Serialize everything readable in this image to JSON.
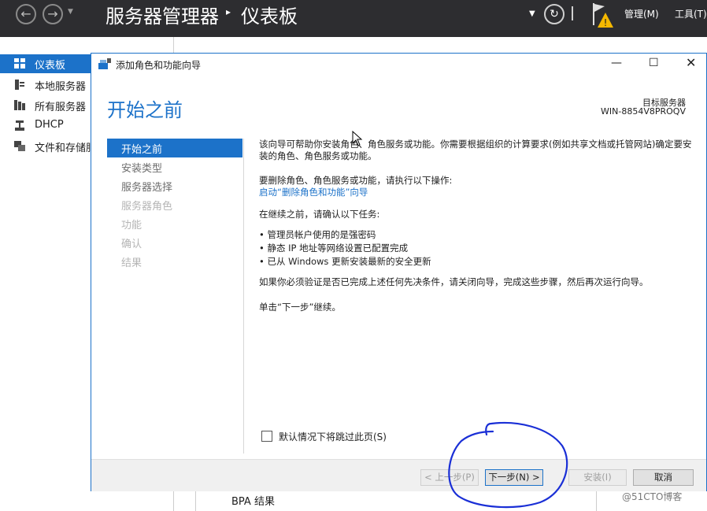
{
  "server_manager": {
    "title": "服务器管理器",
    "separator": "▸",
    "page": "仪表板",
    "menu_manage": "管理(M)",
    "menu_tools": "工具(T)"
  },
  "left_nav": {
    "items": [
      {
        "label": "仪表板"
      },
      {
        "label": "本地服务器"
      },
      {
        "label": "所有服务器"
      },
      {
        "label": "DHCP"
      },
      {
        "label": "文件和存储服务"
      }
    ]
  },
  "background": {
    "bpa_label": "BPA 结果"
  },
  "wizard": {
    "window_title": "添加角色和功能向导",
    "heading": "开始之前",
    "target_label": "目标服务器",
    "target_name": "WIN-8854V8PROQV",
    "steps": [
      {
        "label": "开始之前",
        "state": "active"
      },
      {
        "label": "安装类型",
        "state": "available"
      },
      {
        "label": "服务器选择",
        "state": "available"
      },
      {
        "label": "服务器角色",
        "state": "disabled"
      },
      {
        "label": "功能",
        "state": "disabled"
      },
      {
        "label": "确认",
        "state": "disabled"
      },
      {
        "label": "结果",
        "state": "disabled"
      }
    ],
    "content": {
      "intro": "该向导可帮助你安装角色、角色服务或功能。你需要根据组织的计算要求(例如共享文档或托管网站)确定要安装的角色、角色服务或功能。",
      "remove_prompt": "要删除角色、角色服务或功能，请执行以下操作:",
      "remove_link": "启动“删除角色和功能”向导",
      "before_continue": "在继续之前，请确认以下任务:",
      "tasks": [
        "• 管理员帐户使用的是强密码",
        "• 静态 IP 地址等网络设置已配置完成",
        "• 已从 Windows 更新安装最新的安全更新"
      ],
      "verify_note": "如果你必须验证是否已完成上述任何先决条件，请关闭向导，完成这些步骤，然后再次运行向导。",
      "click_next": "单击“下一步”继续。"
    },
    "skip_checkbox_label": "默认情况下将跳过此页(S)",
    "skip_checked": false,
    "buttons": {
      "prev": "< 上一步(P)",
      "next": "下一步(N) >",
      "install": "安装(I)",
      "cancel": "取消"
    }
  },
  "watermark": "@51CTO博客",
  "colors": {
    "accent": "#1c72c9",
    "topbar": "#2d2d30",
    "annotation": "#1a2fd6",
    "warning": "#f5b800"
  }
}
